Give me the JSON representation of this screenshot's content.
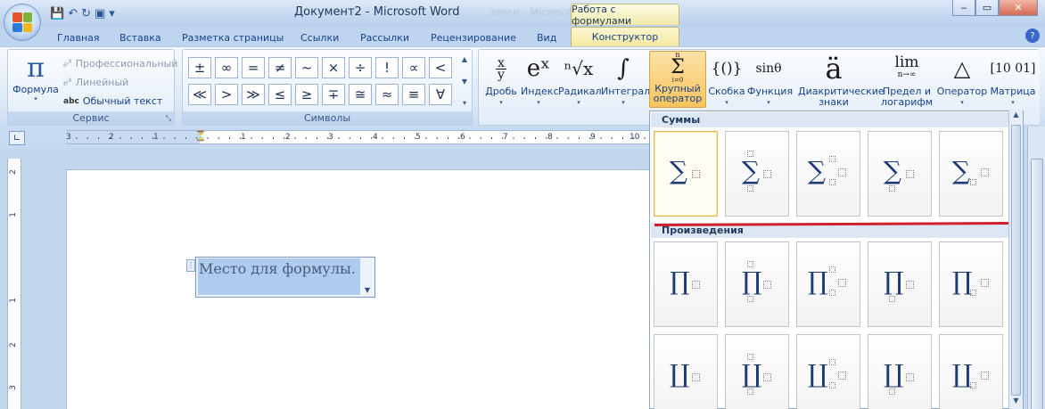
{
  "app": {
    "title": "Документ2 - Microsoft Word",
    "ghost_title": "Зачем - Microsoft",
    "context_tab": "Работа с формулами",
    "accent_color": "#f9c45c",
    "highlight_color": "#d21f2c"
  },
  "qat": {
    "save_icon": "💾",
    "undo_icon": "↶",
    "redo_icon": "↻",
    "picture_icon": "▣",
    "more_icon": "▾"
  },
  "window": {
    "minimize": "‒",
    "maximize": "▭",
    "close": "✕"
  },
  "tabs": [
    {
      "label": "Главная"
    },
    {
      "label": "Вставка"
    },
    {
      "label": "Разметка страницы"
    },
    {
      "label": "Ссылки"
    },
    {
      "label": "Рассылки"
    },
    {
      "label": "Рецензирование"
    },
    {
      "label": "Вид"
    },
    {
      "label": "Конструктор"
    }
  ],
  "help": "?",
  "ribbon": {
    "service": {
      "label": "Сервис",
      "formula_icon": "π",
      "formula_label": "Формула",
      "formula_dd": "▾",
      "professional": "Профессиональный",
      "linear": "Линейный",
      "plain_prefix": "abc",
      "plain": "Обычный текст",
      "launcher": "⤡"
    },
    "symbols": {
      "label": "Символы",
      "items": [
        "±",
        "∞",
        "=",
        "≠",
        "~",
        "×",
        "÷",
        "!",
        "∝",
        "<",
        "≪",
        ">",
        "≫",
        "≤",
        "≥",
        "∓",
        "≅",
        "≈",
        "≡",
        "∀"
      ],
      "scroll_up": "▲",
      "scroll_down": "▼",
      "more": "▾"
    },
    "structures": [
      {
        "glyph": "x/y",
        "label": "Дробь"
      },
      {
        "glyph": "eˣ",
        "label": "Индекс"
      },
      {
        "glyph": "ⁿ√x",
        "label": "Радикал"
      },
      {
        "glyph": "∫",
        "label": "Интеграл"
      },
      {
        "glyph": "Σ",
        "label": "Крупный оператор"
      },
      {
        "glyph": "{()}",
        "label": "Скобка"
      },
      {
        "glyph": "sinθ",
        "label": "Функция"
      },
      {
        "glyph": "ä",
        "label": "Диакритические знаки"
      },
      {
        "glyph": "lim",
        "label": "Предел и логарифм"
      },
      {
        "glyph": "△",
        "label": "Оператор"
      },
      {
        "glyph": "[10 01]",
        "label": "Матрица"
      }
    ],
    "limit_sub": "n→∞",
    "sum_sub": "i=0",
    "sum_sup": "n"
  },
  "ruler": {
    "corner": "∟",
    "numbers": [
      "3",
      "2",
      "1",
      "1",
      "2",
      "3",
      "4",
      "5",
      "6",
      "7",
      "8",
      "9",
      "10"
    ],
    "v_numbers": [
      "2",
      "1",
      "1",
      "2",
      "3"
    ]
  },
  "document": {
    "placeholder": "Место для формулы.",
    "handle": "⋮",
    "dropdown": "▼"
  },
  "gallery": {
    "sections": [
      {
        "title": "Суммы",
        "operator": "∑"
      },
      {
        "title": "Произведения",
        "operator": "∏"
      },
      {
        "title": "",
        "operator": "∐"
      }
    ],
    "scroll_up": "▲",
    "scroll_down": "▼"
  }
}
